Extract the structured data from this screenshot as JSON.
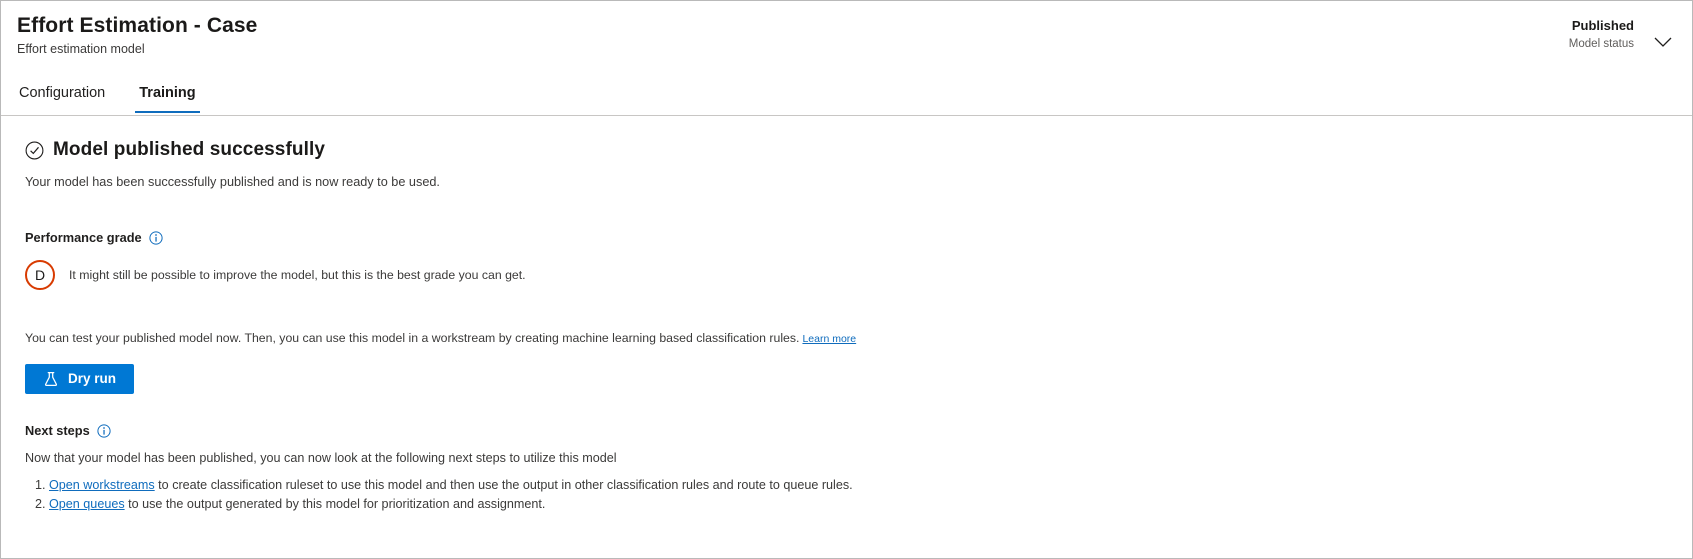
{
  "header": {
    "title": "Effort Estimation - Case",
    "subtitle": "Effort estimation model",
    "status_value": "Published",
    "status_label": "Model status",
    "chevron_icon": "chevron-down-icon"
  },
  "tabs": [
    {
      "label": "Configuration",
      "active": false
    },
    {
      "label": "Training",
      "active": true
    }
  ],
  "main": {
    "success": {
      "icon": "check-circle-icon",
      "title": "Model published successfully",
      "description": "Your model has been successfully published and is now ready to be used."
    },
    "performance": {
      "label": "Performance grade",
      "info_icon": "info-icon",
      "grade": "D",
      "grade_color": "#d83b01",
      "grade_description": "It might still be possible to improve the model, but this is the best grade you can get."
    },
    "test": {
      "text": "You can test your published model now. Then, you can use this model in a workstream by creating machine learning based classification rules.",
      "link_label": "Learn more"
    },
    "dry_run": {
      "label": "Dry run",
      "icon": "flask-icon",
      "color": "#0078d4"
    },
    "next_steps": {
      "label": "Next steps",
      "info_icon": "info-icon",
      "description": "Now that your model has been published, you can now look at the following next steps to utilize this model",
      "items": [
        {
          "link_label": "Open workstreams",
          "text": " to create classification ruleset to use this model and then use the output in other classification rules and route to queue rules."
        },
        {
          "link_label": "Open queues",
          "text": " to use the output generated by this model for prioritization and assignment."
        }
      ]
    }
  }
}
